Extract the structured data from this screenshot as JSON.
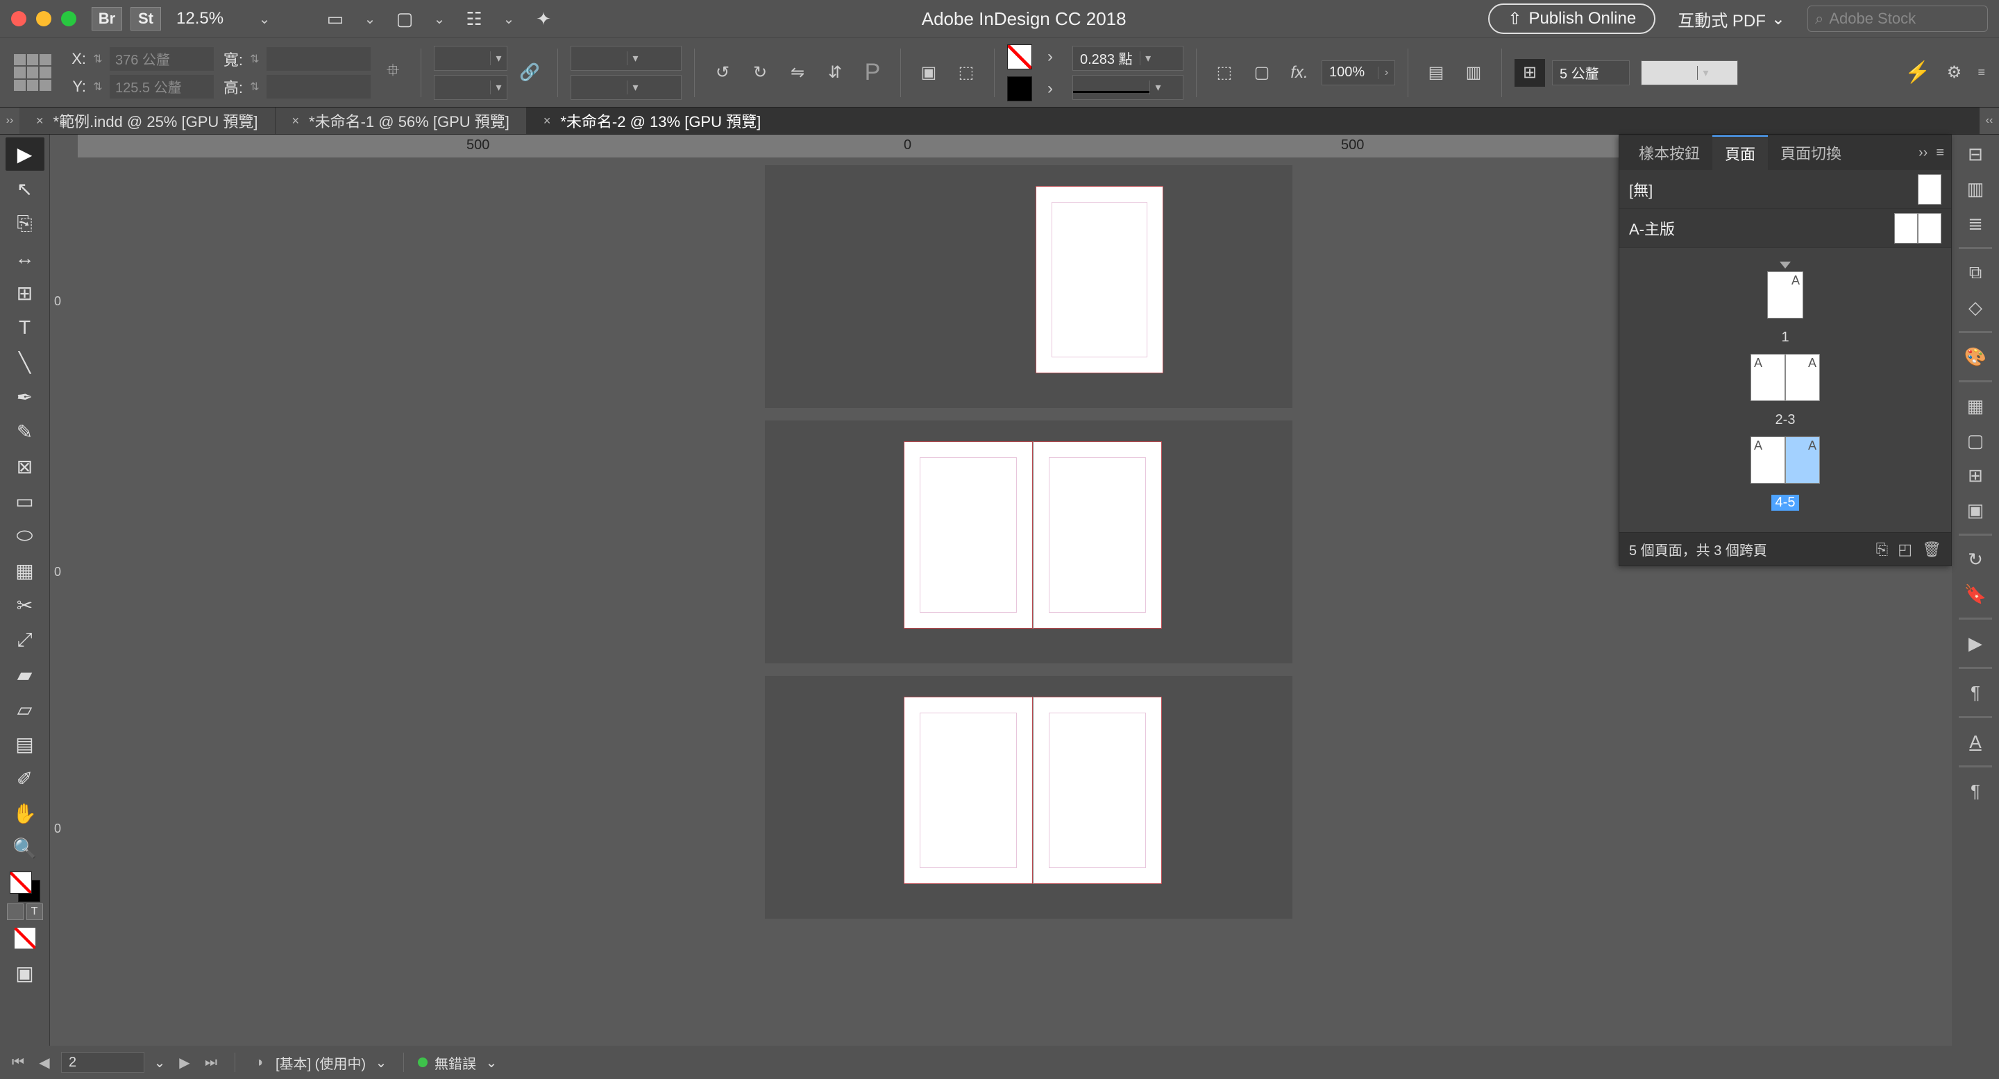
{
  "app": {
    "title": "Adobe InDesign CC 2018",
    "zoom": "12.5%",
    "bridge_label": "Br",
    "stock_label": "St",
    "publish_label": "Publish Online",
    "workspace_label": "互動式 PDF",
    "stock_placeholder": "Adobe Stock"
  },
  "control": {
    "x_label": "X:",
    "y_label": "Y:",
    "x_value": "376 公釐",
    "y_value": "125.5 公釐",
    "w_label": "寬:",
    "h_label": "高:",
    "stroke_weight": "0.283 點",
    "opacity": "100%",
    "dim_value": "5 公釐"
  },
  "tabs": [
    {
      "label": "*範例.indd @ 25% [GPU 預覽]",
      "active": false
    },
    {
      "label": "*未命名-1 @ 56% [GPU 預覽]",
      "active": false
    },
    {
      "label": "*未命名-2 @ 13% [GPU 預覽]",
      "active": true
    }
  ],
  "ruler": {
    "tick_neg": "500",
    "tick_zero": "0",
    "tick_pos": "500",
    "v_marks": [
      "0",
      "0",
      "0"
    ]
  },
  "pages_panel": {
    "tab1": "樣本按鈕",
    "tab2": "頁面",
    "tab3": "頁面切換",
    "master_none": "[無]",
    "master_a": "A-主版",
    "a_letter": "A",
    "labels": {
      "p1": "1",
      "p23": "2-3",
      "p45": "4-5"
    },
    "footer": "5 個頁面，共 3 個跨頁"
  },
  "status": {
    "page": "2",
    "preflight_profile": "[基本] (使用中)",
    "no_errors": "無錯誤"
  }
}
